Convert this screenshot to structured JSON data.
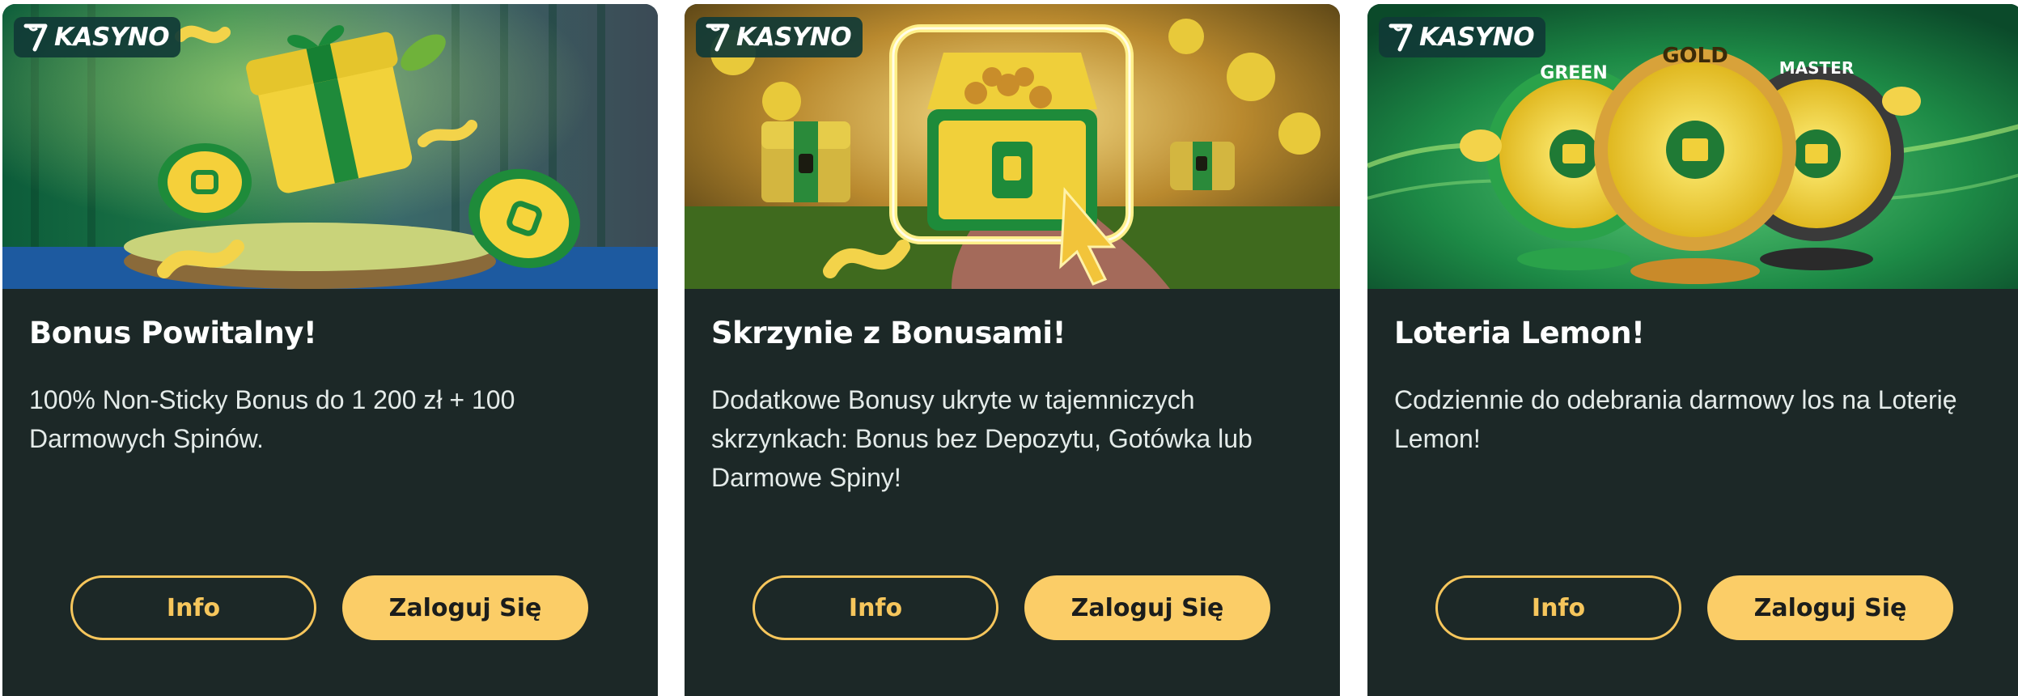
{
  "theme": {
    "card_bg": "#1c2827",
    "accent": "#fbcd67",
    "tag_bg": "#103a36"
  },
  "cards": [
    {
      "tag": {
        "icon": "seven-icon",
        "label": "KASYNO"
      },
      "banner": "gift-box-stage-illustration",
      "title": "Bonus Powitalny!",
      "description": "100% Non-Sticky Bonus do 1 200 zł + 100 Darmowych Spinów.",
      "info_label": "Info",
      "login_label": "Zaloguj Się"
    },
    {
      "tag": {
        "icon": "seven-icon",
        "label": "KASYNO"
      },
      "banner": "treasure-chest-illustration",
      "title": "Skrzynie z Bonusami!",
      "description": "Dodatkowe Bonusy ukryte w tajemniczych skrzynkach: Bonus bez Depozytu, Gotówka lub Darmowe Spiny!",
      "info_label": "Info",
      "login_label": "Zaloguj Się"
    },
    {
      "tag": {
        "icon": "seven-icon",
        "label": "KASYNO"
      },
      "banner": "lottery-wheels-illustration",
      "wheel_labels": [
        "GREEN",
        "GOLD",
        "MASTER"
      ],
      "title": "Loteria Lemon!",
      "description": "Codziennie do odebrania darmowy los na Loterię Lemon!",
      "info_label": "Info",
      "login_label": "Zaloguj Się"
    }
  ]
}
